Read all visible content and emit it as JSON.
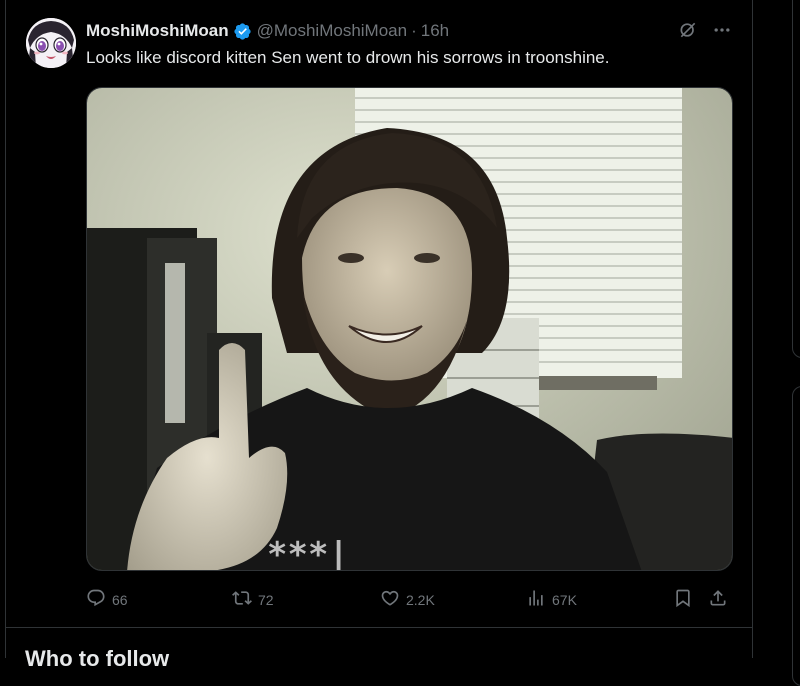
{
  "tweet": {
    "display_name": "MoshiMoshiMoan",
    "handle": "@MoshiMoshiMoan",
    "separator": "·",
    "time": "16h",
    "text": "Looks like discord kitten Sen went to drown his sorrows in troonshine.",
    "verified": true,
    "icons": [
      "grok-icon",
      "more-icon"
    ],
    "stats": {
      "replies": "66",
      "reposts": "72",
      "likes": "2.2K",
      "views": "67K"
    }
  },
  "sections": {
    "who_to_follow": "Who to follow"
  },
  "colors": {
    "background": "#000000",
    "text": "#e7e9ea",
    "muted": "#71767b",
    "border": "#2f3336",
    "verified": "#1d9bf0"
  }
}
